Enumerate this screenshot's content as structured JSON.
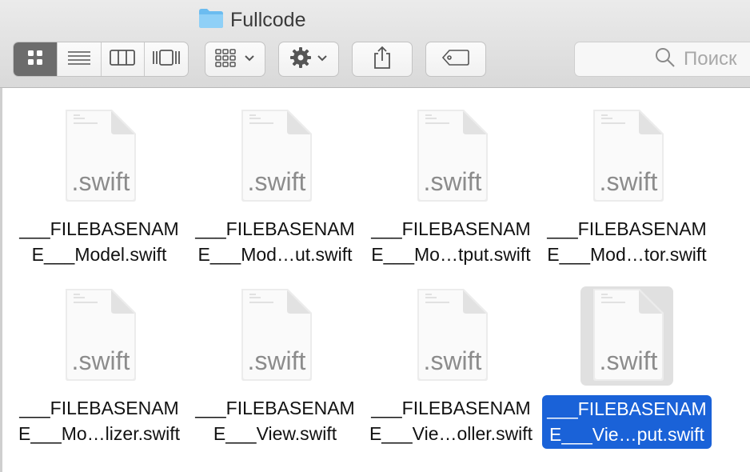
{
  "window": {
    "title": "Fullcode",
    "folder_icon": "folder-icon",
    "accent": "#1a62d8",
    "selection_color": "#1a62d8"
  },
  "toolbar": {
    "view_modes": [
      "icon-view",
      "list-view",
      "column-view",
      "cover-flow-view"
    ],
    "active_view": "icon-view",
    "arrange_icon": "arrange-grid-icon",
    "action_icon": "gear-icon",
    "share_icon": "share-icon",
    "tag_icon": "tag-icon",
    "search_placeholder": "Поиск"
  },
  "files": [
    {
      "line1": "___FILEBASENAM",
      "line2": "E___Model.swift",
      "ext": ".swift",
      "selected": false
    },
    {
      "line1": "___FILEBASENAM",
      "line2": "E___Mod…ut.swift",
      "ext": ".swift",
      "selected": false
    },
    {
      "line1": "___FILEBASENAM",
      "line2": "E___Mo…tput.swift",
      "ext": ".swift",
      "selected": false
    },
    {
      "line1": "___FILEBASENAM",
      "line2": "E___Mod…tor.swift",
      "ext": ".swift",
      "selected": false
    },
    {
      "line1": "___FILEBASENAM",
      "line2": "E___Mo…lizer.swift",
      "ext": ".swift",
      "selected": false
    },
    {
      "line1": "___FILEBASENAM",
      "line2": "E___View.swift",
      "ext": ".swift",
      "selected": false
    },
    {
      "line1": "___FILEBASENAM",
      "line2": "E___Vie…oller.swift",
      "ext": ".swift",
      "selected": false
    },
    {
      "line1": "___FILEBASENAM",
      "line2": "E___Vie…put.swift",
      "ext": ".swift",
      "selected": true
    }
  ]
}
